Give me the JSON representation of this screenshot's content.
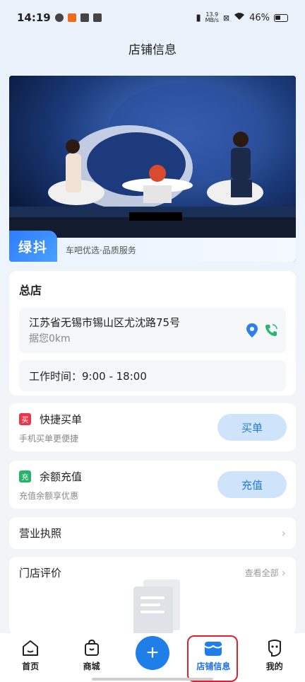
{
  "status_bar": {
    "time": "14:19",
    "net_speed_top": "13.9",
    "net_speed_bottom": "MB/s",
    "battery": "46%"
  },
  "header": {
    "title": "店铺信息"
  },
  "banner": {
    "brand_logo": "绿抖",
    "slogan": "车吧优选·品质服务"
  },
  "store": {
    "name": "总店",
    "address": "江苏省无锡市锡山区尤沈路75号",
    "distance": "据您0km",
    "hours": "工作时间：9:00 - 18:00"
  },
  "quick_buy": {
    "badge": "买",
    "title": "快捷买单",
    "subtitle": "手机买单更便捷",
    "button": "买单",
    "badge_color": "#e8374a"
  },
  "recharge": {
    "badge": "充",
    "title": "余额充值",
    "subtitle": "充值余额享优惠",
    "button": "充值",
    "badge_color": "#27b36a"
  },
  "license": {
    "title": "营业执照"
  },
  "reviews": {
    "title": "门店评价",
    "view_all": "查看全部"
  },
  "tabbar": {
    "home": "首页",
    "mall": "商城",
    "plus": "+",
    "store_info": "店铺信息",
    "mine": "我的"
  },
  "colors": {
    "accent": "#1f7ee8",
    "button_bg": "#cfe4fb",
    "highlight": "#d9232f"
  }
}
